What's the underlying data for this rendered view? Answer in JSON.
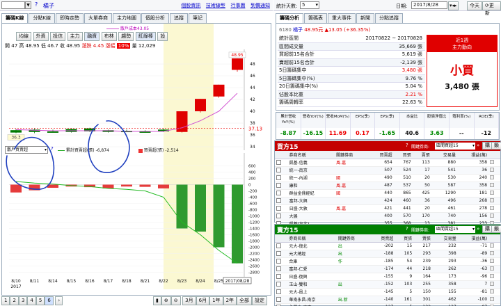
{
  "top_left": {
    "stock_code": "",
    "stock_name": "橘子",
    "links": [
      "個股資訊",
      "技術線型",
      "行事曆",
      "到價通知"
    ]
  },
  "top_right": {
    "stats_days_label": "統計天數:",
    "stats_days_value": "5",
    "date_label": "日期:",
    "date_value": "2017/8/28",
    "today_btn": "今天",
    "refresh_btn": "更新"
  },
  "left_tabs": [
    "籌碼K線",
    "分點K線",
    "即時走勢",
    "大單券商",
    "主力地圖",
    "個股分析",
    "追蹤",
    "筆記"
  ],
  "ma_legend": "散戶成本43.05",
  "toolbar_buttons": [
    "均線",
    "外資",
    "投信",
    "主力",
    "融資",
    "布林",
    "趨勢",
    "紅綠棒",
    "設"
  ],
  "ohlc": {
    "open_label": "開",
    "open": "47",
    "high_label": "高",
    "high": "48.95",
    "low_label": "低",
    "low": "46.7",
    "close_label": "收",
    "close": "48.95",
    "change_label": "漲跌",
    "change": "4.45",
    "pct_label": "漲幅",
    "pct": "10%",
    "vol_label": "量",
    "vol": "12,029"
  },
  "price_axis": [
    "48",
    "46",
    "44",
    "42",
    "40",
    "38",
    "36",
    "34"
  ],
  "last_price_tag": "37.13",
  "high_tag": "48.95",
  "low_tag": "36.3",
  "lower_select": "散戶買賣超",
  "lower_legend": {
    "line": "累計買賣超(張)",
    "line_val": "-6,874",
    "bar": "買賣超(張)",
    "bar_val": "-2,514"
  },
  "vol_axis": [
    "600",
    "400",
    "200",
    "0",
    "-200",
    "-400",
    "-600",
    "-800",
    "-1000",
    "-1200",
    "-1400",
    "-1600",
    "-1800",
    "-2000",
    "-2200",
    "-2400",
    "-2600",
    "-2800"
  ],
  "x_dates": [
    "8/10",
    "8/11",
    "8/14",
    "8/15",
    "8/16",
    "8/17",
    "8/18",
    "8/21",
    "8/22",
    "8/23",
    "8/24",
    "8/25",
    "8/28"
  ],
  "x_year": "2017",
  "cursor_date": "2017/08/28",
  "bottom_pages": [
    "1",
    "2",
    "3",
    "4",
    "5",
    "6"
  ],
  "bottom_ranges": [
    "3月",
    "6月",
    "1年",
    "2年",
    "全部",
    "設定"
  ],
  "right_tabs": [
    "籌碼分析",
    "籌碼表",
    "重大事件",
    "新聞",
    "分點追蹤"
  ],
  "quote": {
    "code": "6180",
    "name": "橘子",
    "price": "48.95元",
    "change": "▲13.05 (+36.35%)"
  },
  "stats": {
    "rows": [
      {
        "label": "統計區間",
        "value": "20170822 ~ 20170828"
      },
      {
        "label": "區間成交量",
        "value": "35,669 張"
      },
      {
        "label": "買超前15名合計",
        "value": "5,619 張"
      },
      {
        "label": "賣超前15名合計",
        "value": "-2,139 張"
      },
      {
        "label": "5日籌碼集中",
        "value": "3,480 張",
        "red": true
      },
      {
        "label": "5日籌碼集中(%)",
        "value": "9.76 %"
      },
      {
        "label": "20日籌碼集中(%)",
        "value": "5.04 %"
      },
      {
        "label": "佔股本比重",
        "value": "2.21 %",
        "red": true
      },
      {
        "label": "籌碼周轉率",
        "value": "22.63 %"
      }
    ],
    "box_title1": "近1週",
    "box_title2": "主力動向",
    "box_big": "小買",
    "box_value": "3,480 張"
  },
  "fundamentals": {
    "headers": [
      "累計營收YoY(%)",
      "營收YoY(%)",
      "營收MoM(%)",
      "EPS(季)",
      "EPS(季)",
      "本益比",
      "股價淨值比",
      "殖利率(%)",
      "ROE(季)"
    ],
    "values": [
      "-8.87",
      "-16.15",
      "11.69",
      "0.17",
      "-1.65",
      "40.6",
      "3.63",
      "--",
      "-12"
    ],
    "colors": [
      "green",
      "green",
      "red",
      "red",
      "green",
      "",
      "green",
      "",
      ""
    ]
  },
  "buy": {
    "title": "買方15",
    "filter_label": "關鍵券商:",
    "filter_value": "區間買超15",
    "btns": [
      "»",
      "購",
      "鎖"
    ],
    "headers": [
      "",
      "券商名稱",
      "關鍵券商",
      "買賣超",
      "買張",
      "賣張",
      "交易量",
      "損益(萬)",
      ""
    ],
    "rows": [
      [
        "凱基-信義",
        "風.嘉",
        "654",
        "767",
        "113",
        "880",
        "358"
      ],
      [
        "統一-南京",
        "",
        "507",
        "524",
        "17",
        "541",
        "36"
      ],
      [
        "統一-內湖",
        "國",
        "490",
        "510",
        "20",
        "530",
        "240"
      ],
      [
        "康和",
        "風.嘉",
        "487",
        "537",
        "50",
        "587",
        "358"
      ],
      [
        "群益金鼎經紀",
        "國",
        "440",
        "865",
        "425",
        "1290",
        "181"
      ],
      [
        "富邦-大興",
        "",
        "424",
        "460",
        "36",
        "496",
        "268"
      ],
      [
        "日盛-大敦",
        "風.嘉",
        "421",
        "441",
        "20",
        "461",
        "278"
      ],
      [
        "大展",
        "",
        "400",
        "570",
        "170",
        "740",
        "156"
      ],
      [
        "凱基(台北)",
        "",
        "355",
        "368",
        "13",
        "381",
        "233"
      ]
    ]
  },
  "sell": {
    "title": "賣方15",
    "filter_label": "關鍵券商:",
    "filter_value": "區間賣超15",
    "btns": [
      "»",
      "購",
      "鎖"
    ],
    "headers": [
      "",
      "券商名稱",
      "關鍵券商",
      "買賣超",
      "買張",
      "賣張",
      "交易量",
      "損益(萬)",
      ""
    ],
    "rows": [
      [
        "元大-復北",
        "出",
        "-202",
        "15",
        "217",
        "232",
        "-71"
      ],
      [
        "元大總經",
        "出",
        "-188",
        "105",
        "293",
        "398",
        "-89"
      ],
      [
        "合庫",
        "作",
        "-185",
        "54",
        "239",
        "293",
        "-36"
      ],
      [
        "富邦-仁愛",
        "",
        "-174",
        "44",
        "218",
        "262",
        "-63"
      ],
      [
        "日盛-復興",
        "",
        "-155",
        "9",
        "164",
        "173",
        "-96"
      ],
      [
        "玉山-雙和",
        "出",
        "-152",
        "103",
        "255",
        "358",
        "7"
      ],
      [
        "元大-員上",
        "",
        "-145",
        "5",
        "150",
        "155",
        "-81"
      ],
      [
        "華南永昌-南京",
        "出.新",
        "-140",
        "161",
        "301",
        "462",
        "-100"
      ],
      [
        "永豐金-東京",
        "",
        "-127",
        "5",
        "132",
        "137",
        "-87"
      ]
    ]
  },
  "chart_data": {
    "type": "candlestick",
    "dates": [
      "8/10",
      "8/11",
      "8/14",
      "8/15",
      "8/16",
      "8/17",
      "8/18",
      "8/21",
      "8/22",
      "8/23",
      "8/24",
      "8/25",
      "8/28"
    ],
    "candles": [
      {
        "o": 36.8,
        "c": 36.4,
        "h": 37.0,
        "l": 36.3
      },
      {
        "o": 36.9,
        "c": 36.5,
        "h": 37.1,
        "l": 36.3
      },
      {
        "o": 36.6,
        "c": 36.6,
        "h": 36.9,
        "l": 36.5
      },
      {
        "o": 37.0,
        "c": 36.5,
        "h": 37.1,
        "l": 36.4
      },
      {
        "o": 37.1,
        "c": 36.6,
        "h": 37.2,
        "l": 36.5
      },
      {
        "o": 36.8,
        "c": 36.5,
        "h": 36.9,
        "l": 36.4
      },
      {
        "o": 36.7,
        "c": 36.7,
        "h": 36.9,
        "l": 36.6
      },
      {
        "o": 36.6,
        "c": 36.6,
        "h": 36.8,
        "l": 36.5
      },
      {
        "o": 36.9,
        "c": 36.6,
        "h": 37.1,
        "l": 36.5
      },
      {
        "o": 36.5,
        "c": 40.0,
        "h": 40.0,
        "l": 36.4
      },
      {
        "o": 40.0,
        "c": 42.1,
        "h": 42.1,
        "l": 39.8
      },
      {
        "o": 42.5,
        "c": 44.5,
        "h": 44.5,
        "l": 42.3
      },
      {
        "o": 47.0,
        "c": 48.95,
        "h": 48.95,
        "l": 46.7
      }
    ],
    "ma": [
      36.9,
      36.8,
      36.7,
      36.7,
      36.7,
      36.7,
      36.6,
      36.6,
      36.6,
      37.2,
      38.4,
      40.0,
      43.05
    ],
    "net_buy": [
      -250,
      -180,
      -100,
      -60,
      -80,
      -120,
      -60,
      -70,
      -120,
      -1400,
      -1500,
      -2000,
      -2514
    ],
    "cumulative": [
      100,
      50,
      20,
      -30,
      -60,
      -120,
      -150,
      -200,
      -400,
      -1200,
      -1600,
      -2100,
      -2514
    ],
    "ylim_price": [
      34,
      50
    ],
    "ylim_volume": [
      -2900,
      700
    ]
  }
}
